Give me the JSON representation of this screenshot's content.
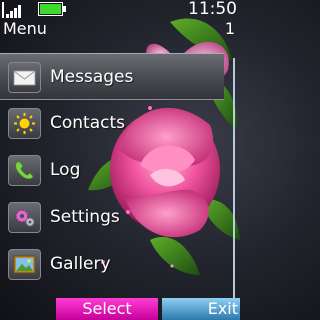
{
  "status": {
    "clock": "11:50",
    "screen_title": "Menu",
    "page_index": "1",
    "battery_level": 1.0,
    "signal_icon": "signal-bars-icon",
    "battery_icon": "battery-icon"
  },
  "menu": {
    "items": [
      {
        "label": "Messages",
        "icon": "envelope-icon",
        "selected": true
      },
      {
        "label": "Contacts",
        "icon": "sun-contacts-icon",
        "selected": false
      },
      {
        "label": "Log",
        "icon": "phone-handset-icon",
        "selected": false
      },
      {
        "label": "Settings",
        "icon": "gears-icon",
        "selected": false
      },
      {
        "label": "Gallery",
        "icon": "picture-icon",
        "selected": false
      }
    ]
  },
  "softkeys": {
    "left": "Select",
    "right": "Exit"
  },
  "colors": {
    "accent_left_softkey": "#e01ab8",
    "accent_right_softkey": "#4a9ad0",
    "battery_fill": "#3ddc2c"
  }
}
